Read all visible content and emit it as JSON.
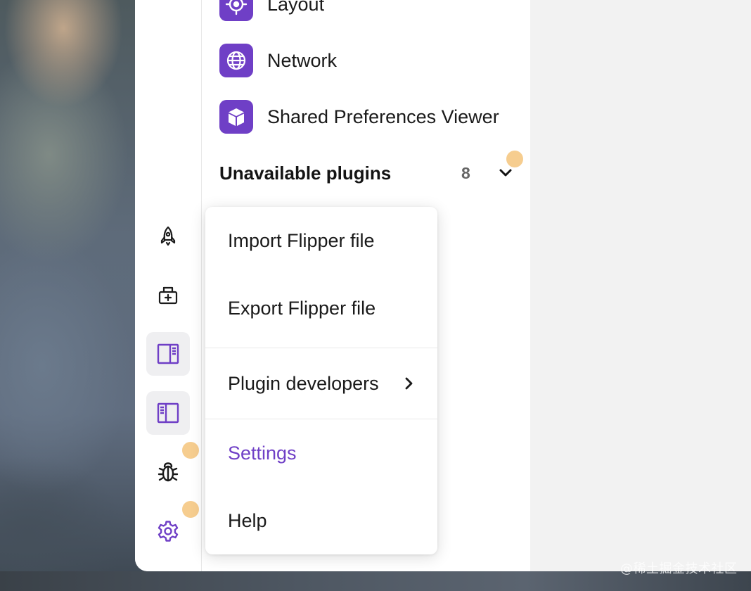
{
  "plugins": {
    "items": [
      {
        "label": "Layout",
        "icon": "target-icon"
      },
      {
        "label": "Network",
        "icon": "globe-icon"
      },
      {
        "label": "Shared Preferences Viewer",
        "icon": "cube-icon"
      }
    ],
    "unavailable": {
      "label": "Unavailable plugins",
      "count": "8"
    }
  },
  "rail": {
    "icons": [
      "rocket-icon",
      "add-device-icon",
      "toggle-right-sidebar-icon",
      "toggle-left-sidebar-icon",
      "bug-icon",
      "gear-icon"
    ]
  },
  "menu": {
    "import_label": "Import Flipper file",
    "export_label": "Export Flipper file",
    "plugin_dev_label": "Plugin developers",
    "settings_label": "Settings",
    "help_label": "Help"
  },
  "watermark": "@稀土掘金技术社区",
  "colors": {
    "accent": "#6f3fc6",
    "notification_dot": "#f5c883",
    "main_bg": "#f2f2f2"
  }
}
